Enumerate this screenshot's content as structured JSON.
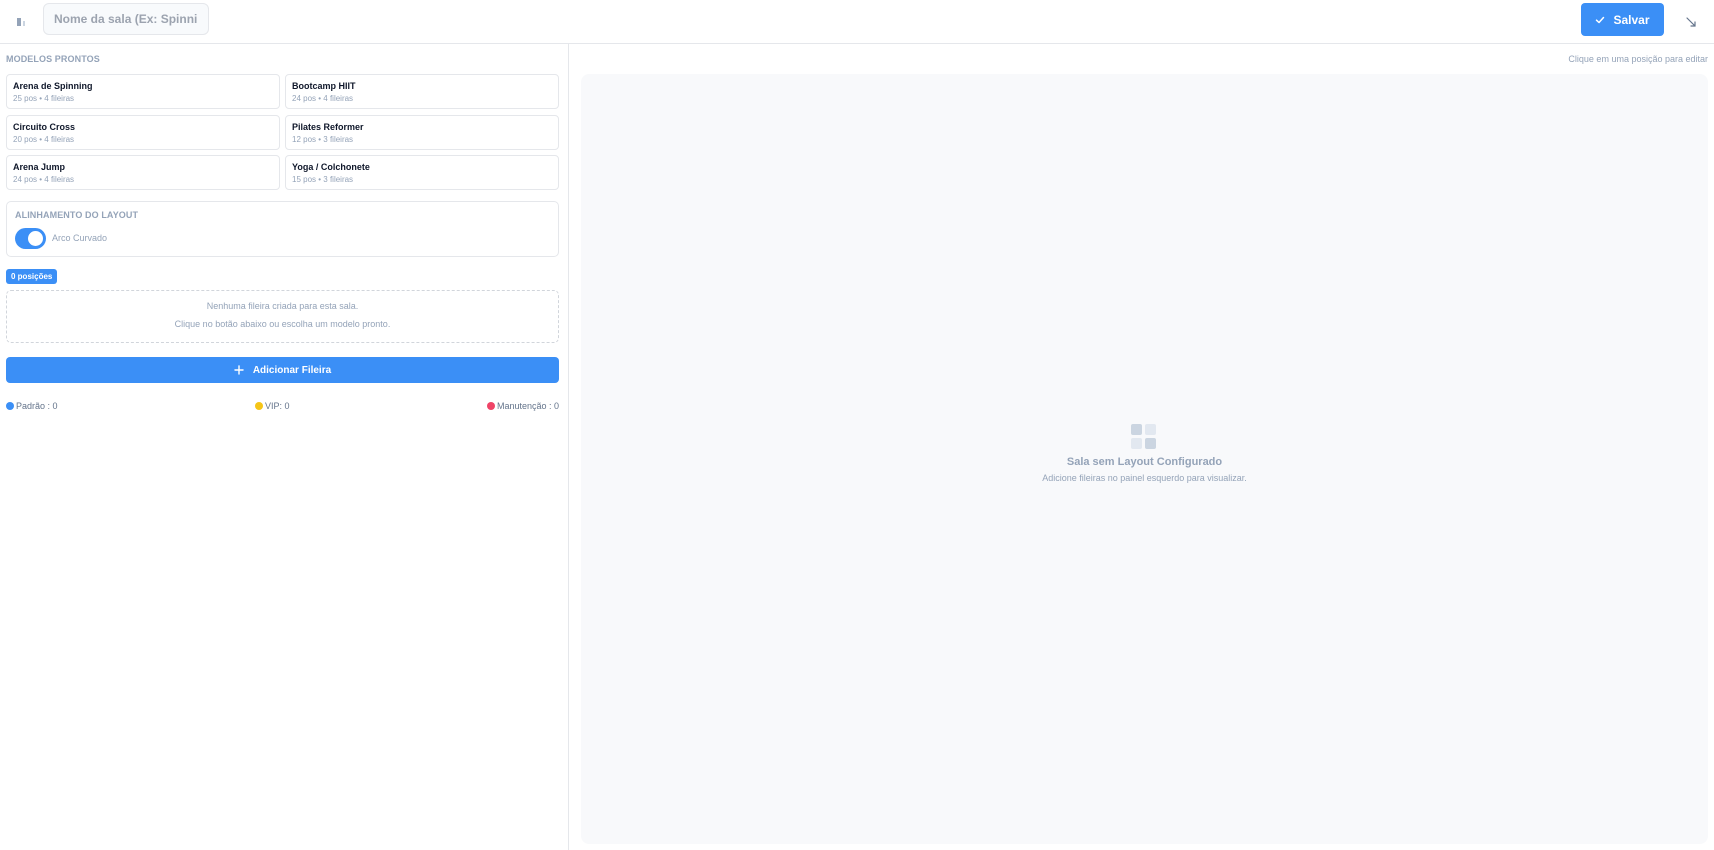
{
  "header": {
    "room_name_placeholder": "Nome da sala (Ex: Spinning)",
    "room_name_value": "",
    "save_label": "Salvar"
  },
  "left": {
    "templates_title": "MODELOS PRONTOS",
    "templates": [
      {
        "name": "Arena de Spinning",
        "meta": "25 pos • 4 fileiras"
      },
      {
        "name": "Bootcamp HIIT",
        "meta": "24 pos • 4 fileiras"
      },
      {
        "name": "Circuito Cross",
        "meta": "20 pos • 4 fileiras"
      },
      {
        "name": "Pilates Reformer",
        "meta": "12 pos • 3 fileiras"
      },
      {
        "name": "Arena Jump",
        "meta": "24 pos • 4 fileiras"
      },
      {
        "name": "Yoga / Colchonete",
        "meta": "15 pos • 3 fileiras"
      }
    ],
    "layout_alignment": {
      "title": "ALINHAMENTO DO LAYOUT",
      "toggle_label": "Arco Curvado",
      "enabled": true
    },
    "positions_badge": "0 posições",
    "empty_rows": {
      "line1": "Nenhuma fileira criada para esta sala.",
      "line2": "Clique no botão abaixo ou escolha um modelo pronto."
    },
    "add_row_label": "Adicionar Fileira",
    "legend": [
      {
        "label": "Padrão : 0",
        "color": "#3b8ff6"
      },
      {
        "label": "VIP: 0",
        "color": "#f5c518"
      },
      {
        "label": "Manutenção : 0",
        "color": "#ef4467"
      }
    ]
  },
  "right": {
    "hint": "Clique em uma posição para editar",
    "empty_title": "Sala sem Layout Configurado",
    "empty_desc": "Adicione fileiras no painel esquerdo para visualizar."
  }
}
